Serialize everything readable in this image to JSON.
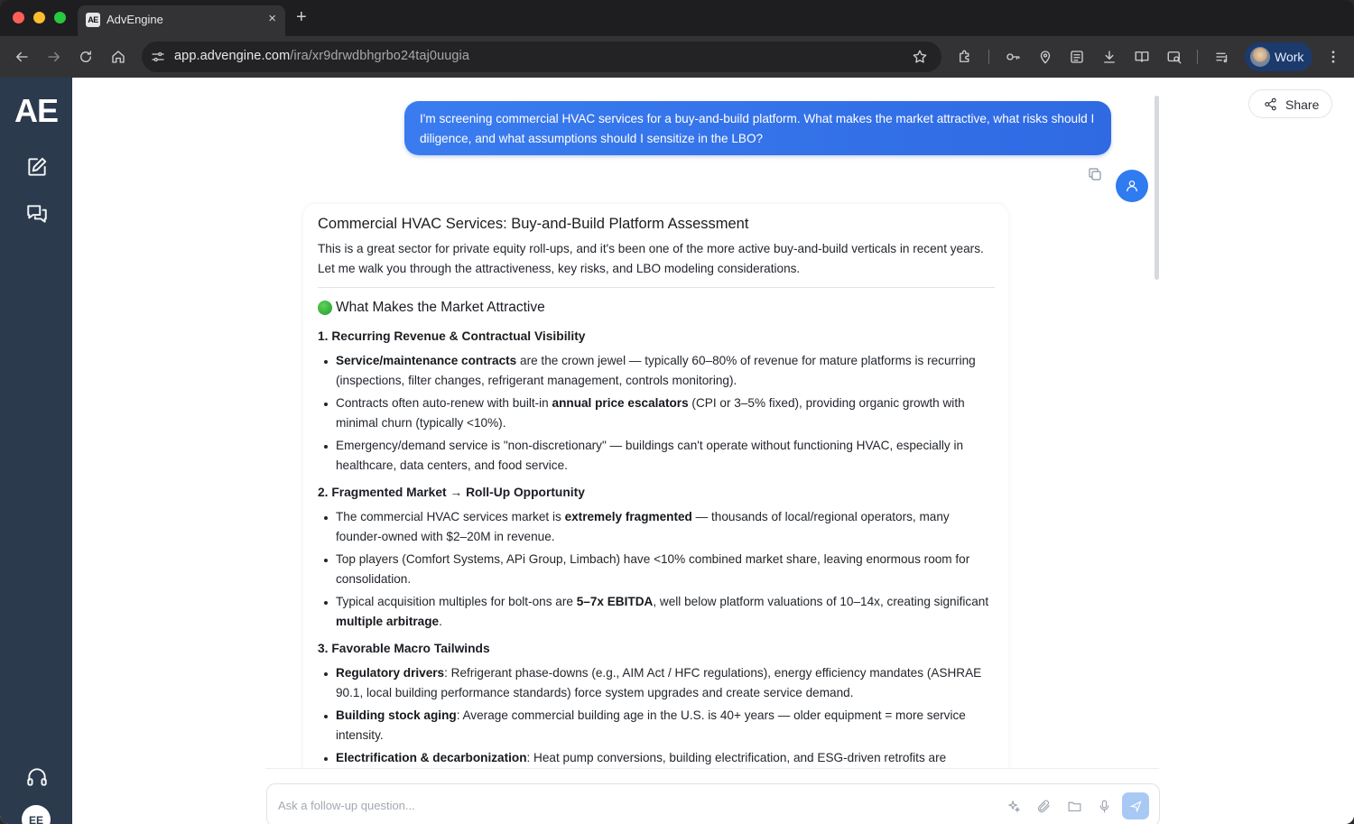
{
  "browser": {
    "tab_title": "AdvEngine",
    "tab_favicon": "AE",
    "new_tab_symbol": "+",
    "close_symbol": "×",
    "url_host": "app.advengine.com",
    "url_path": "/ira/xr9drwdbhgrbo24taj0uugia",
    "profile_label": "Work"
  },
  "sidebar": {
    "logo": "AE",
    "items": [
      {
        "icon": "edit-icon"
      },
      {
        "icon": "chat-icon"
      },
      {
        "icon": "headset-icon"
      }
    ],
    "user_initials": "EE"
  },
  "header": {
    "share_label": "Share"
  },
  "conversation": {
    "user_message": "I'm screening commercial HVAC services for a buy-and-build platform. What makes the market attractive, what risks should I diligence, and what assumptions should I sensitize in the LBO?",
    "reply": {
      "title": "Commercial HVAC Services: Buy-and-Build Platform Assessment",
      "intro": "This is a great sector for private equity roll-ups, and it's been one of the more active buy-and-build verticals in recent years. Let me walk you through the attractiveness, key risks, and LBO modeling considerations.",
      "section_title": "What Makes the Market Attractive",
      "subsections": [
        {
          "heading": "1. Recurring Revenue & Contractual Visibility",
          "bullets": [
            {
              "bold": "Service/maintenance contracts",
              "rest": " are the crown jewel — typically 60–80% of revenue for mature platforms is recurring (inspections, filter changes, refrigerant management, controls monitoring)."
            },
            {
              "pre": "Contracts often auto-renew with built-in ",
              "bold": "annual price escalators",
              "rest": " (CPI or 3–5% fixed), providing organic growth with minimal churn (typically <10%)."
            },
            {
              "pre": "Emergency/demand service is \"non-discretionary\" — buildings can't operate without functioning HVAC, especially in healthcare, data centers, and food service."
            }
          ]
        },
        {
          "heading": "2. Fragmented Market → Roll-Up Opportunity",
          "bullets": [
            {
              "pre": "The commercial HVAC services market is ",
              "bold": "extremely fragmented",
              "rest": " — thousands of local/regional operators, many founder-owned with $2–20M in revenue."
            },
            {
              "pre": "Top players (Comfort Systems, APi Group, Limbach) have <10% combined market share, leaving enormous room for consolidation."
            },
            {
              "pre": "Typical acquisition multiples for bolt-ons are ",
              "bold": "5–7x EBITDA",
              "rest": ", well below platform valuations of 10–14x, creating significant ",
              "bold2": "multiple arbitrage",
              "rest2": "."
            }
          ]
        },
        {
          "heading": "3. Favorable Macro Tailwinds",
          "bullets": [
            {
              "bold": "Regulatory drivers",
              "rest": ": Refrigerant phase-downs (e.g., AIM Act / HFC regulations), energy efficiency mandates (ASHRAE 90.1, local building performance standards) force system upgrades and create service demand."
            },
            {
              "bold": "Building stock aging",
              "rest": ": Average commercial building age in the U.S. is 40+ years — older equipment = more service intensity."
            },
            {
              "bold": "Electrification & decarbonization",
              "rest": ": Heat pump conversions, building electrification, and ESG-driven retrofits are"
            }
          ]
        }
      ]
    }
  },
  "composer": {
    "placeholder": "Ask a follow-up question..."
  },
  "colors": {
    "sidebar_bg": "#2b3a4c",
    "accent_blue": "#2f7bf0",
    "send_disabled": "#a9c9f5"
  }
}
